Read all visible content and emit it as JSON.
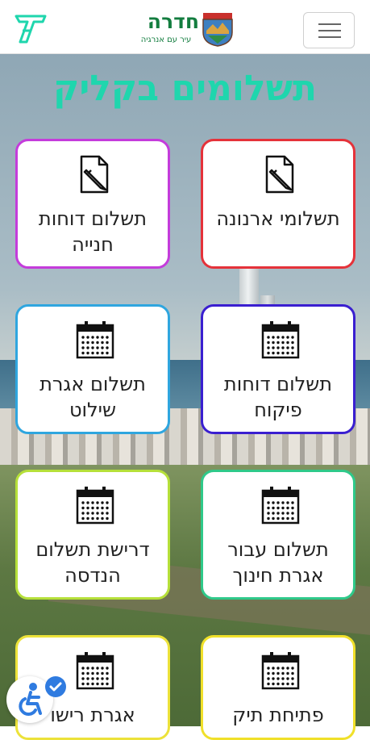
{
  "header": {
    "city_name": "חדרה",
    "slogan": "עיר עם אנרגיה",
    "logo_icon": "t-logo-icon",
    "crest_icon": "city-crest-icon",
    "menu_icon": "hamburger-menu-icon"
  },
  "page": {
    "title": "תשלומים בקליק"
  },
  "tiles": [
    {
      "label": "תשלומי ארנונה",
      "icon": "document-pencil-icon",
      "border": "#e5323a"
    },
    {
      "label": "תשלום דוחות חנייה",
      "icon": "document-pencil-icon",
      "border": "#c43cdb"
    },
    {
      "label": "תשלום דוחות פיקוח",
      "icon": "calendar-icon",
      "border": "#3a1fd0"
    },
    {
      "label": "תשלום אגרת שילוט",
      "icon": "calendar-icon",
      "border": "#2fa6df"
    },
    {
      "label": "תשלום עבור אגרת חינוך",
      "icon": "calendar-icon",
      "border": "#2fc98a"
    },
    {
      "label": "דרישת תשלום הנדסה",
      "icon": "calendar-icon",
      "border": "#b6e03a"
    },
    {
      "label": "פתיחת תיק",
      "icon": "calendar-icon",
      "border": "#f0e02a"
    },
    {
      "label": "אגרת רישו",
      "icon": "calendar-icon",
      "border": "#ece23a"
    }
  ],
  "colors": {
    "title": "#1fd6ad",
    "brand_green": "#137d3f",
    "accessibility": "#2f7be0"
  },
  "accessibility": {
    "icon": "accessibility-icon"
  }
}
